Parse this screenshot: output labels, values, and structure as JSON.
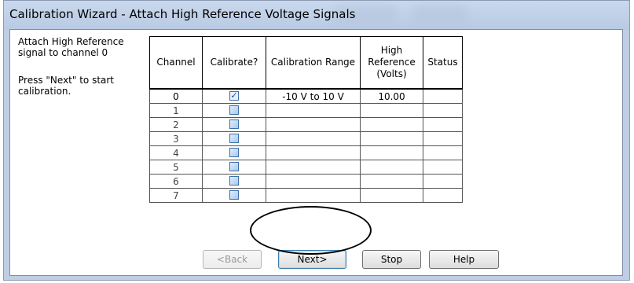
{
  "window": {
    "title": "Calibration Wizard - Attach High Reference Voltage Signals"
  },
  "instructions": {
    "line1": "Attach High Reference signal to channel  0",
    "line2": "Press \"Next\" to start calibration."
  },
  "table": {
    "headers": {
      "channel": "Channel",
      "calibrate": "Calibrate?",
      "range": "Calibration Range",
      "high_ref": "High Reference (Volts)",
      "status": "Status"
    },
    "rows": [
      {
        "channel": "0",
        "calibrate": true,
        "range": "-10 V to 10 V",
        "high_ref": "10.00",
        "status": ""
      },
      {
        "channel": "1",
        "calibrate": false,
        "range": "",
        "high_ref": "",
        "status": ""
      },
      {
        "channel": "2",
        "calibrate": false,
        "range": "",
        "high_ref": "",
        "status": ""
      },
      {
        "channel": "3",
        "calibrate": false,
        "range": "",
        "high_ref": "",
        "status": ""
      },
      {
        "channel": "4",
        "calibrate": false,
        "range": "",
        "high_ref": "",
        "status": ""
      },
      {
        "channel": "5",
        "calibrate": false,
        "range": "",
        "high_ref": "",
        "status": ""
      },
      {
        "channel": "6",
        "calibrate": false,
        "range": "",
        "high_ref": "",
        "status": ""
      },
      {
        "channel": "7",
        "calibrate": false,
        "range": "",
        "high_ref": "",
        "status": ""
      }
    ]
  },
  "buttons": {
    "back": "<Back",
    "next": "Next>",
    "stop": "Stop",
    "help": "Help"
  }
}
